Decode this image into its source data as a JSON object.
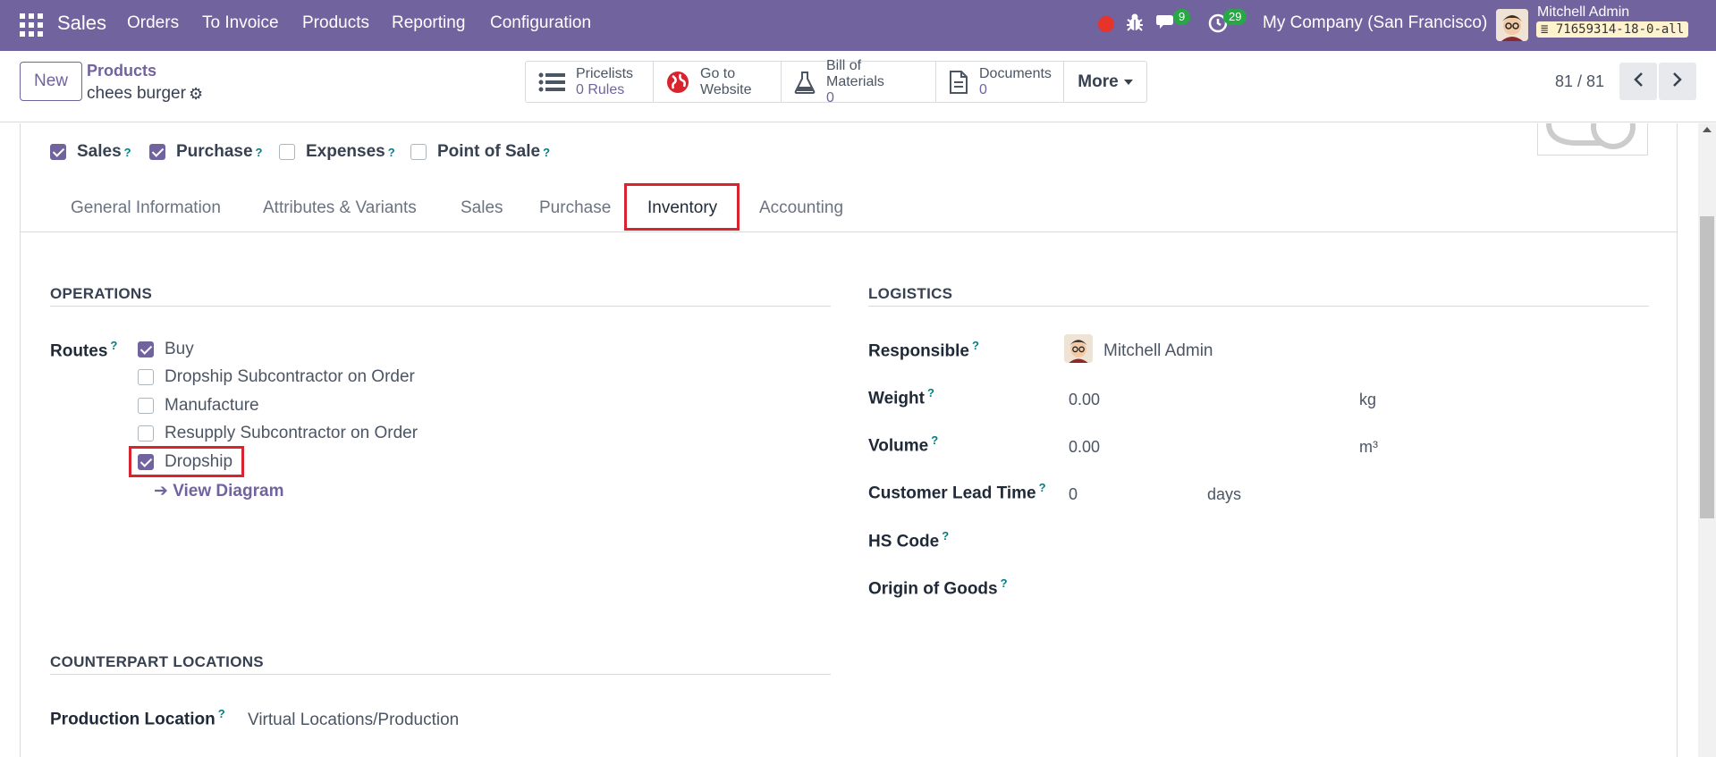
{
  "navbar": {
    "app_name": "Sales",
    "menus": [
      "Orders",
      "To Invoice",
      "Products",
      "Reporting",
      "Configuration"
    ],
    "chat_count": "9",
    "activity_count": "29",
    "company": "My Company (San Francisco)",
    "user_name": "Mitchell Admin",
    "db_name": "71659314-18-0-all",
    "accent_color": "#71639e"
  },
  "control": {
    "new_label": "New",
    "breadcrumb_parent": "Products",
    "breadcrumb_current": "chees burger",
    "smart_buttons": [
      {
        "line1": "Pricelists",
        "line2": "0  Rules",
        "icon": "list-icon"
      },
      {
        "line1": "Go to",
        "line2": "Website",
        "icon": "globe-icon"
      },
      {
        "line1": "Bill of Materials",
        "line2": "0",
        "icon": "flask-icon"
      },
      {
        "line1": "Documents",
        "line2": "0",
        "icon": "document-icon"
      }
    ],
    "more_label": "More",
    "pager": "81 / 81"
  },
  "product_flags": [
    {
      "label": "Sales",
      "checked": true
    },
    {
      "label": "Purchase",
      "checked": true
    },
    {
      "label": "Expenses",
      "checked": false
    },
    {
      "label": "Point of Sale",
      "checked": false
    }
  ],
  "tabs": [
    "General Information",
    "Attributes & Variants",
    "Sales",
    "Purchase",
    "Inventory",
    "Accounting"
  ],
  "active_tab": "Inventory",
  "operations": {
    "title": "OPERATIONS",
    "routes_label": "Routes",
    "routes": [
      {
        "label": "Buy",
        "checked": true
      },
      {
        "label": "Dropship Subcontractor on Order",
        "checked": false
      },
      {
        "label": "Manufacture",
        "checked": false
      },
      {
        "label": "Resupply Subcontractor on Order",
        "checked": false
      },
      {
        "label": "Dropship",
        "checked": true
      }
    ],
    "view_diagram": "View Diagram"
  },
  "logistics": {
    "title": "LOGISTICS",
    "responsible_label": "Responsible",
    "responsible_value": "Mitchell Admin",
    "weight_label": "Weight",
    "weight_value": "0.00",
    "weight_unit": "kg",
    "volume_label": "Volume",
    "volume_value": "0.00",
    "volume_unit": "m³",
    "lead_time_label": "Customer Lead Time",
    "lead_time_value": "0",
    "lead_time_unit": "days",
    "hs_code_label": "HS Code",
    "origin_label": "Origin of Goods"
  },
  "counterpart": {
    "title": "COUNTERPART LOCATIONS",
    "production_label": "Production Location",
    "production_value": "Virtual Locations/Production"
  }
}
